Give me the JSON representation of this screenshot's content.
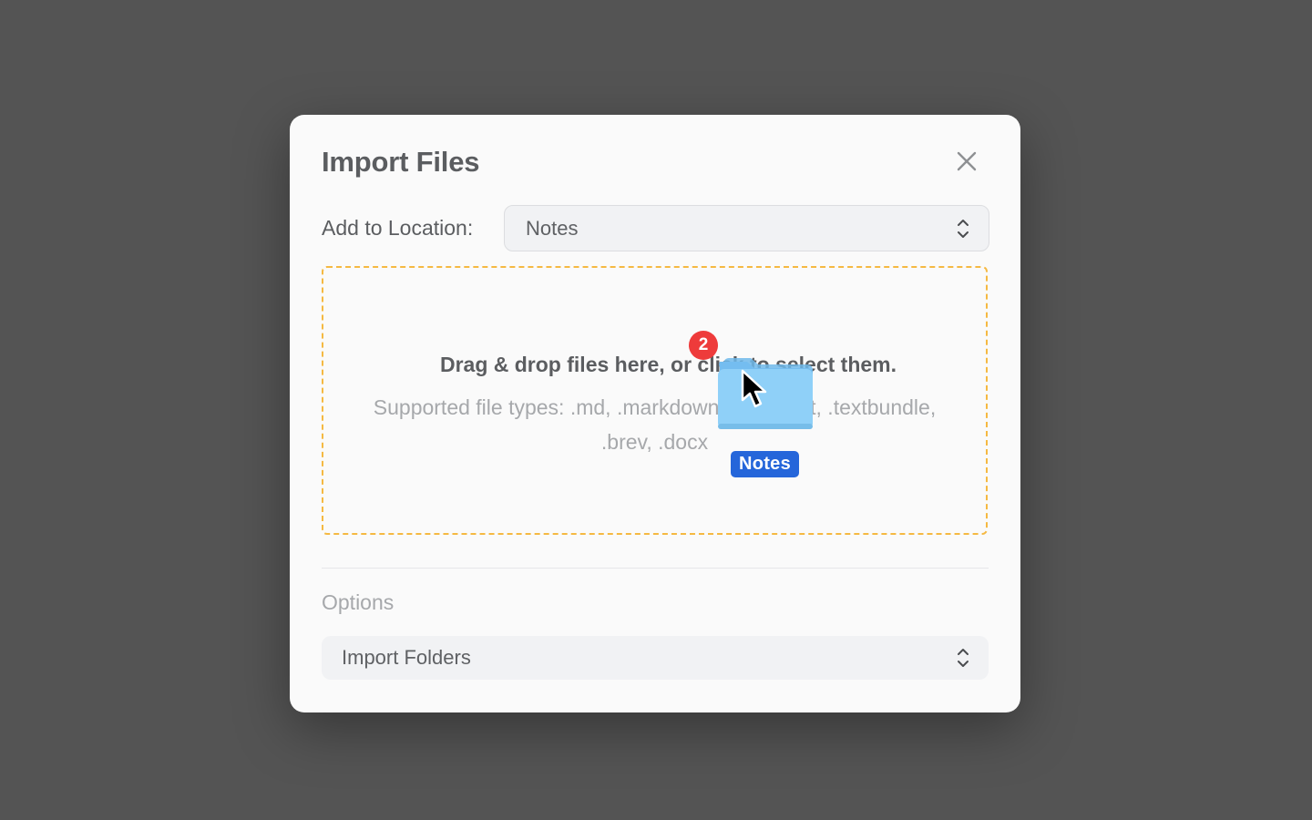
{
  "dialog": {
    "title": "Import Files",
    "location_label": "Add to Location:",
    "location_value": "Notes",
    "dropzone_title": "Drag & drop files here, or click to select them.",
    "dropzone_subtitle_line1": "Supported file types: .md, .markdown, .html, .txt, .textbundle,",
    "dropzone_subtitle_line2": ".brev, .docx",
    "options_label": "Options",
    "import_folders_value": "Import Folders"
  },
  "drag_overlay": {
    "item_count": "2",
    "item_label": "Notes"
  },
  "colors": {
    "backdrop": "#545454",
    "dropzone_border": "#f5b942",
    "badge": "#ee3b3b",
    "drag_label_bg": "#2566da",
    "folder_fill": "#8fd0f8"
  }
}
